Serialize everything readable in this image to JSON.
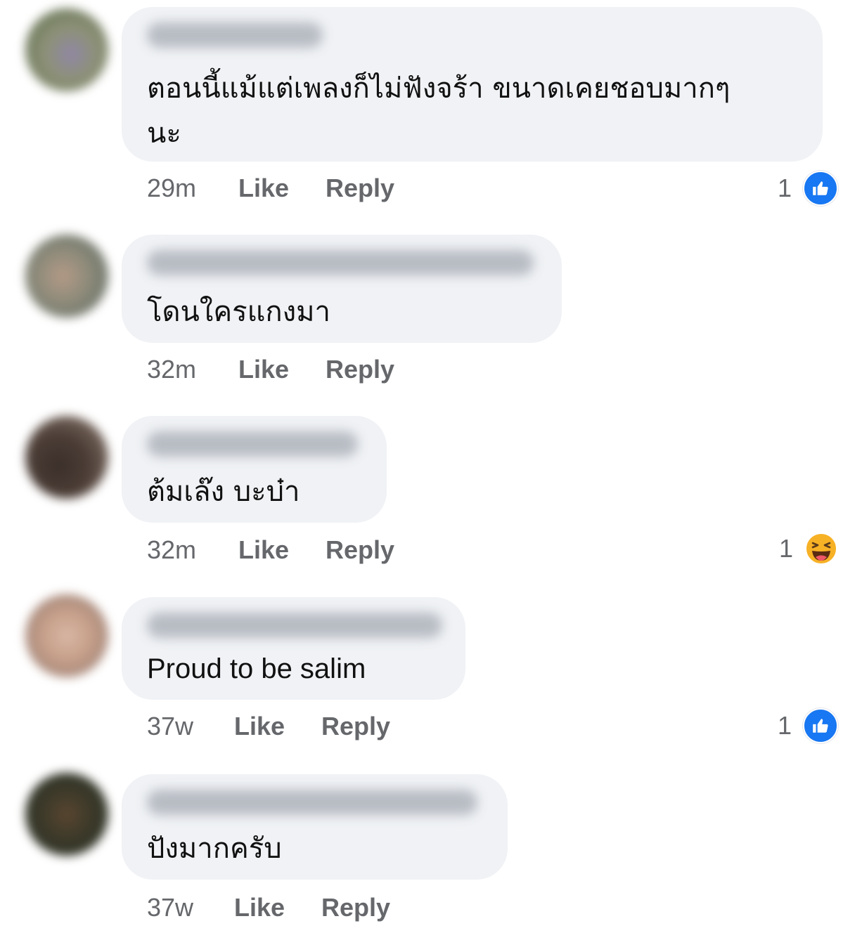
{
  "colors": {
    "bubble_bg": "#f0f2f5",
    "like_blue": "#1877f2",
    "haha_yellow": "#f7b125",
    "meta_gray": "#65676b"
  },
  "actions": {
    "like_label": "Like",
    "reply_label": "Reply"
  },
  "comments": [
    {
      "text_line1": "ตอนนี้แม้แต่เพลงก็ไม่ฟังจร้า ขนาดเคยชอบมากๆ",
      "text_line2": "นะ",
      "time": "29m",
      "reaction": {
        "count": "1",
        "icon": "like-icon"
      }
    },
    {
      "text": "โดนใครแกงมา",
      "time": "32m"
    },
    {
      "text": "ต้มเล๊ง บะบ๋า",
      "time": "32m",
      "reaction": {
        "count": "1",
        "icon": "haha-icon"
      }
    },
    {
      "text": "Proud to be salim",
      "time": "37w",
      "reaction": {
        "count": "1",
        "icon": "like-icon"
      }
    },
    {
      "text": "ปังมากครับ",
      "time": "37w"
    }
  ]
}
